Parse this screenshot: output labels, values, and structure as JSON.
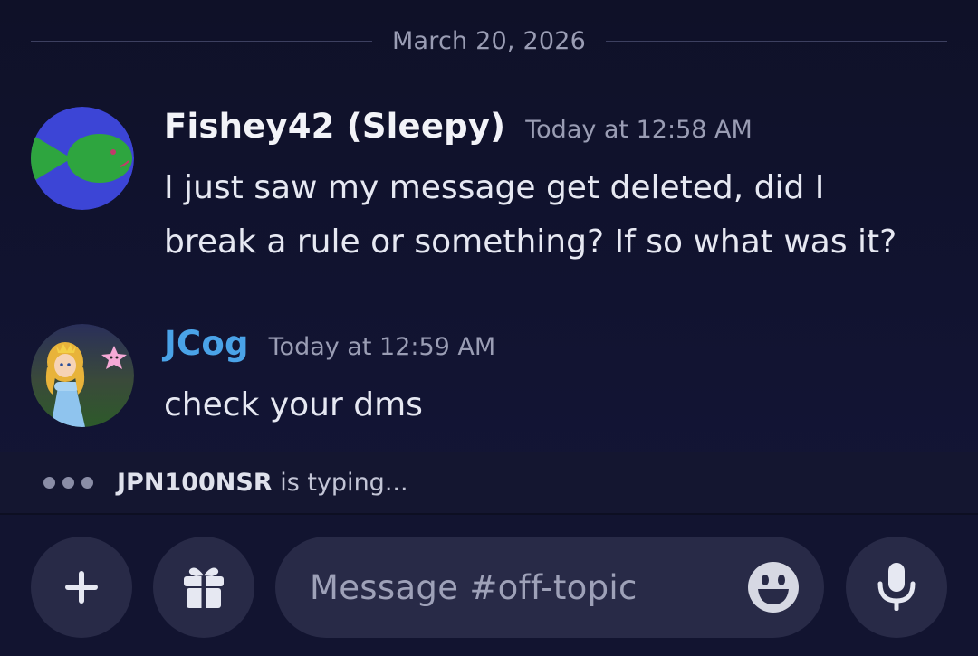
{
  "date_divider": "March 20, 2026",
  "messages": [
    {
      "username": "Fishey42 (Sleepy)",
      "timestamp": "Today at 12:58 AM",
      "lines": [
        "I just saw my message get deleted, did I",
        "break a rule or something? If so what was it?"
      ],
      "avatar": "fish-avatar"
    },
    {
      "username": "JCog",
      "timestamp": "Today at 12:59 AM",
      "lines": [
        "check your dms"
      ],
      "avatar": "princess-avatar",
      "name_color": "#4aa3e8"
    }
  ],
  "typing": {
    "user": "JPN100NSR",
    "suffix": " is typing..."
  },
  "composer": {
    "placeholder": "Message #off-topic",
    "buttons": [
      "plus-icon",
      "gift-icon",
      "emoji-icon",
      "microphone-icon"
    ]
  },
  "colors": {
    "background": "#111330",
    "accent_blue": "#4aa3e8",
    "input_bg": "#282a47"
  }
}
